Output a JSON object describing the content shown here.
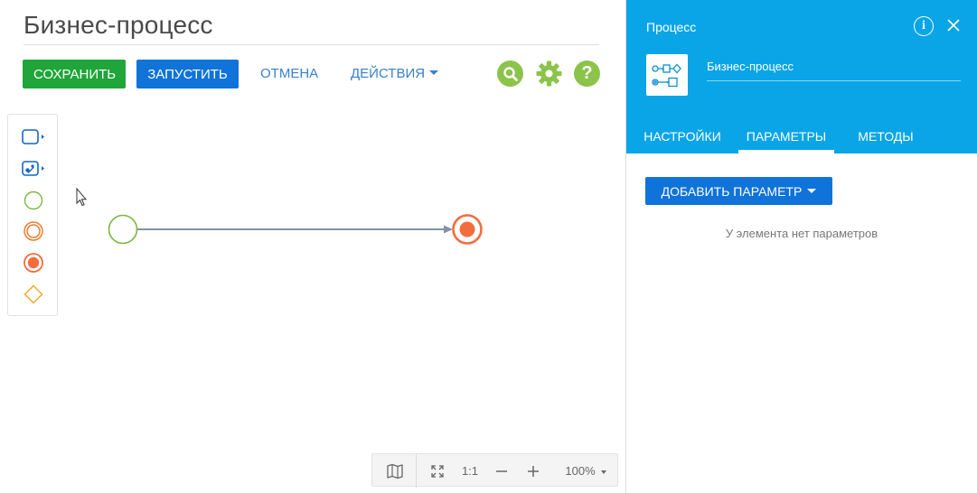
{
  "page": {
    "title": "Бизнес-процесс"
  },
  "toolbar": {
    "save_label": "СОХРАНИТЬ",
    "run_label": "ЗАПУСТИТЬ",
    "cancel_label": "ОТМЕНА",
    "actions_label": "ДЕЙСТВИЯ",
    "icons": [
      "search-icon",
      "gear-icon",
      "help-icon"
    ],
    "help_glyph": "?"
  },
  "palette": {
    "items": [
      "user-task-icon",
      "auto-task-icon",
      "start-event-icon",
      "intermediate-event-icon",
      "end-event-icon",
      "gateway-icon"
    ]
  },
  "canvas": {
    "elements": [
      "start-event",
      "sequence-flow",
      "end-event"
    ]
  },
  "zoombar": {
    "actual_size_label": "1:1",
    "zoom_level": "100%"
  },
  "panel": {
    "label": "Процесс",
    "info_glyph": "i",
    "process_name": "Бизнес-процесс",
    "tabs": [
      {
        "label": "НАСТРОЙКИ",
        "active": false
      },
      {
        "label": "ПАРАМЕТРЫ",
        "active": true
      },
      {
        "label": "МЕТОДЫ",
        "active": false
      }
    ],
    "add_param_label": "ДОБАВИТЬ ПАРАМЕТР",
    "empty_message": "У элемента нет параметров"
  },
  "colors": {
    "primary": "#0f73d9",
    "success": "#1fa53a",
    "panel_header": "#09a5e6",
    "accent_green": "#8cc34a",
    "event_end": "#f26d3d",
    "event_start": "#7cb744"
  }
}
